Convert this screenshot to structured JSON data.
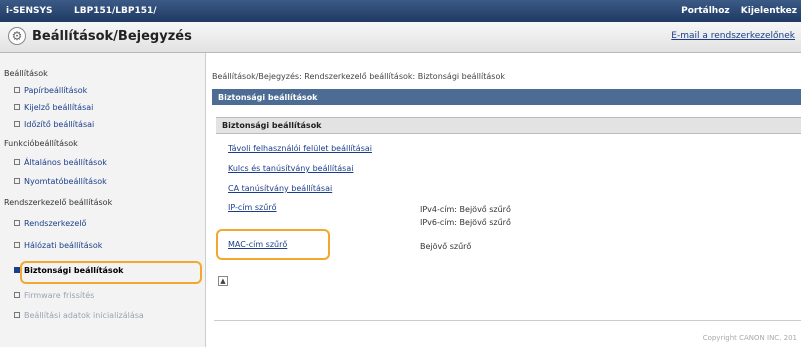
{
  "topbar": {
    "brand": "i-SENSYS",
    "model": "LBP151/LBP151/",
    "link_portal": "Portálhoz",
    "link_logout": "Kijelentkez"
  },
  "header": {
    "title": "Beállítások/Bejegyzés",
    "email_link": "E-mail a rendszerkezelőnek"
  },
  "sidebar": {
    "cat_settings": "Beállítások",
    "item_paper": "Papírbeállítások",
    "item_output": "Kijelző beállításai",
    "item_timer": "Időzítő beállításai",
    "cat_functions": "Funkcióbeállítások",
    "item_general": "Általános beállítások",
    "item_printer": "Nyomtatóbeállítások",
    "cat_admin": "Rendszerkezelő beállítások",
    "item_sysadmin": "Rendszerkezelő",
    "item_network": "Hálózati beállítások",
    "item_security": "Biztonsági beállítások",
    "item_firmware": "Firmware frissítés",
    "item_init": "Beállítási adatok inicializálása"
  },
  "main": {
    "breadcrumb": "Beállítások/Bejegyzés: Rendszerkezelő beállítások: Biztonsági beállítások",
    "section_title": "Biztonsági beállítások",
    "subsection_title": "Biztonsági beállítások",
    "link_remote_ui": "Távoli felhasználói felület beállításai",
    "link_key_cert": "Kulcs és tanúsítvány beállításai",
    "link_ca_cert": "CA tanúsítvány beállításai",
    "link_ip_filter": "IP-cím szűrő",
    "value_ipv4": "IPv4-cím: Bejövő szűrő",
    "value_ipv6": "IPv6-cím: Bejövő szűrő",
    "link_mac_filter": "MAC-cím szűrő",
    "value_mac": "Bejövő szűrő"
  },
  "footer": {
    "copyright": "Copyright CANON INC. 201"
  },
  "colors": {
    "highlight": "#f0a92e",
    "header_bar": "#4d6c94",
    "link": "#1a3e8a"
  }
}
